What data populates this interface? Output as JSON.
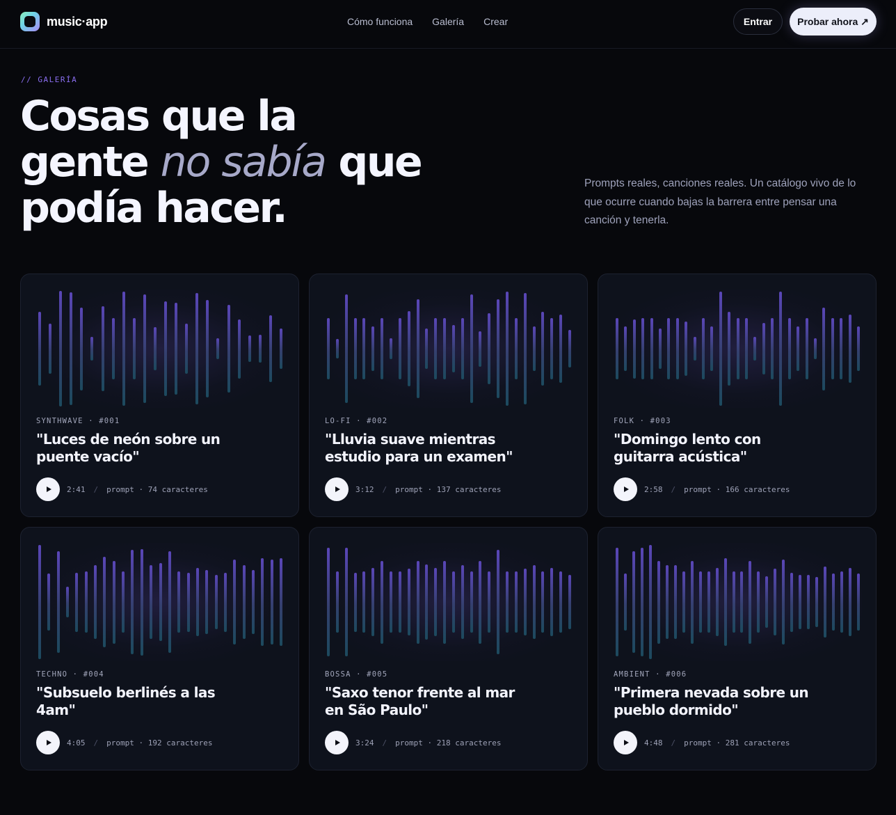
{
  "header": {
    "brand": "music·app",
    "nav": [
      "Cómo funciona",
      "Galería",
      "Crear"
    ],
    "login_label": "Entrar",
    "try_label": "Probar ahora ↗"
  },
  "hero": {
    "eyebrow": "// GALERÍA",
    "title_line1": "Cosas que la",
    "title_line2_start": "gente ",
    "title_line2_em": "no sabía",
    "title_line2_end": " que",
    "title_line3": "podía hacer.",
    "description": "Prompts reales, canciones reales. Un catálogo vivo de lo que ocurre cuando bajas la barrera entre pensar una canción y tenerla."
  },
  "cards": [
    {
      "tag": "SYNTHWAVE · #001",
      "title": "\"Luces de neón sobre un puente vacío\"",
      "duration": "2:41",
      "prompt_info": "prompt · 74 caracteres"
    },
    {
      "tag": "LO-FI · #002",
      "title": "\"Lluvia suave mientras estudio para un examen\"",
      "duration": "3:12",
      "prompt_info": "prompt · 137 caracteres"
    },
    {
      "tag": "FOLK · #003",
      "title": "\"Domingo lento con guitarra acústica\"",
      "duration": "2:58",
      "prompt_info": "prompt · 166 caracteres"
    },
    {
      "tag": "TECHNO · #004",
      "title": "\"Subsuelo berlinés a las 4am\"",
      "duration": "4:05",
      "prompt_info": "prompt · 192 caracteres"
    },
    {
      "tag": "BOSSA · #005",
      "title": "\"Saxo tenor frente al mar en São Paulo\"",
      "duration": "3:24",
      "prompt_info": "prompt · 218 caracteres"
    },
    {
      "tag": "AMBIENT · #006",
      "title": "\"Primera nevada sobre un pueblo dormido\"",
      "duration": "4:48",
      "prompt_info": "prompt · 281 caracteres"
    }
  ],
  "icons": {
    "play": "play-icon"
  },
  "colors": {
    "background": "#07080c",
    "card": "#0e121c",
    "accent": "#8a6ef0",
    "bar_top": "#5a46b8",
    "bar_bottom": "#1c4a5e"
  }
}
